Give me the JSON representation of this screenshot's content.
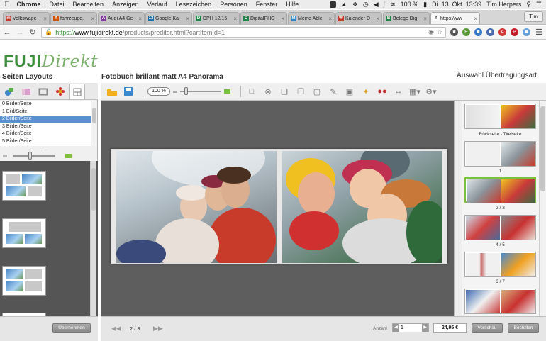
{
  "menubar": {
    "app": "Chrome",
    "items": [
      "Datei",
      "Bearbeiten",
      "Anzeigen",
      "Verlauf",
      "Lesezeichen",
      "Personen",
      "Fenster",
      "Hilfe"
    ],
    "battery": "100 %",
    "datetime": "Di. 13. Okt. 13:39",
    "user": "Tim Herpers"
  },
  "tabs": [
    {
      "label": "Volkswage",
      "color": "#c0392b",
      "letter": "m"
    },
    {
      "label": "fahrzeuge.",
      "color": "#d35400",
      "letter": "f"
    },
    {
      "label": "Audi A4 Ge",
      "color": "#7d3c98",
      "letter": "A"
    },
    {
      "label": "Google Ka",
      "color": "#2471a3",
      "letter": "13"
    },
    {
      "label": "DPH 12/15",
      "color": "#1e8449",
      "letter": "D"
    },
    {
      "label": "DigitalPHO",
      "color": "#1e8449",
      "letter": "D"
    },
    {
      "label": "Meine Able",
      "color": "#2e86c1",
      "letter": "M"
    },
    {
      "label": "Kalender D",
      "color": "#c0392b",
      "letter": "W"
    },
    {
      "label": "Belege Dig",
      "color": "#1e8449",
      "letter": "B"
    },
    {
      "label": "https://ww",
      "color": "#fff",
      "letter": "f",
      "active": true
    }
  ],
  "profile": "Tim",
  "address": {
    "https": "https://",
    "host": "www.fujidirekt.de",
    "path": "/products/preditor.html?cartItemId=1"
  },
  "logo": {
    "part1": "FUJI",
    "part2": "Direkt"
  },
  "left_title": "Seiten Layouts",
  "editor_title": "Fotobuch brillant matt A4 Panorama",
  "transfer_label": "Auswahl Übertragungsart",
  "layout_list": [
    "0 Bilder/Seite",
    "1 Bild/Seite",
    "2 Bilder/Seite",
    "3 Bilder/Seite",
    "4 Bilder/Seite",
    "5 Bilder/Seite"
  ],
  "layout_selected": 2,
  "zoom": "100 %",
  "right_labels": [
    "Rückseite - Titelseite",
    "1",
    "2 / 3",
    "4 / 5",
    "6 / 7"
  ],
  "bottom": {
    "apply_button": "Übernehmen",
    "page_indicator": "2 / 3",
    "quantity_label": "Anzahl",
    "quantity": "1",
    "price": "24,95 €",
    "preview_button": "Vorschau",
    "order_button": "Bestellen"
  }
}
